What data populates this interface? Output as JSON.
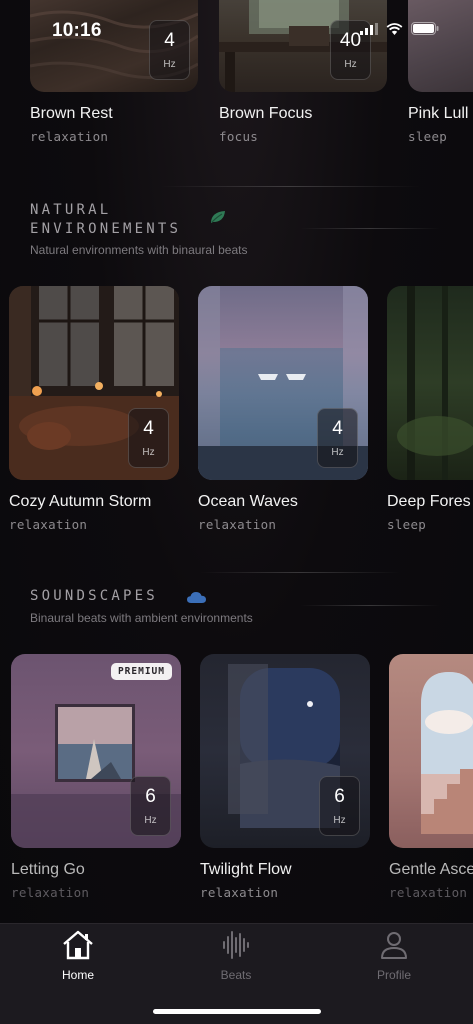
{
  "status": {
    "time": "10:16"
  },
  "top_row": [
    {
      "title": "Brown Rest",
      "category": "relaxation",
      "hz": "4",
      "unit": "Hz"
    },
    {
      "title": "Brown Focus",
      "category": "focus",
      "hz": "40",
      "unit": "Hz"
    },
    {
      "title": "Pink Lull",
      "category": "sleep"
    }
  ],
  "sections": {
    "natural": {
      "title_line1": "NATURAL",
      "title_line2": "ENVIRONEMENTS",
      "icon": "leaf-icon",
      "subtitle": "Natural environments with binaural beats",
      "items": [
        {
          "title": "Cozy Autumn Storm",
          "category": "relaxation",
          "hz": "4",
          "unit": "Hz"
        },
        {
          "title": "Ocean Waves",
          "category": "relaxation",
          "hz": "4",
          "unit": "Hz"
        },
        {
          "title": "Deep Fores",
          "category": "sleep"
        }
      ]
    },
    "soundscapes": {
      "title": "SOUNDSCAPES",
      "icon": "cloud-icon",
      "subtitle": "Binaural beats with ambient environments",
      "items": [
        {
          "title": "Letting Go",
          "category": "relaxation",
          "hz": "6",
          "unit": "Hz",
          "badge": "PREMIUM"
        },
        {
          "title": "Twilight Flow",
          "category": "relaxation",
          "hz": "6",
          "unit": "Hz"
        },
        {
          "title": "Gentle Asce",
          "category": "relaxation"
        }
      ]
    }
  },
  "tabs": [
    {
      "label": "Home",
      "icon": "home-icon",
      "active": true
    },
    {
      "label": "Beats",
      "icon": "waveform-icon",
      "active": false
    },
    {
      "label": "Profile",
      "icon": "person-icon",
      "active": false
    }
  ],
  "colors": {
    "leaf": "#2f7a55",
    "cloud": "#3b6fb8",
    "tab_active": "#ffffff",
    "tab_inactive": "#6f6c72"
  }
}
